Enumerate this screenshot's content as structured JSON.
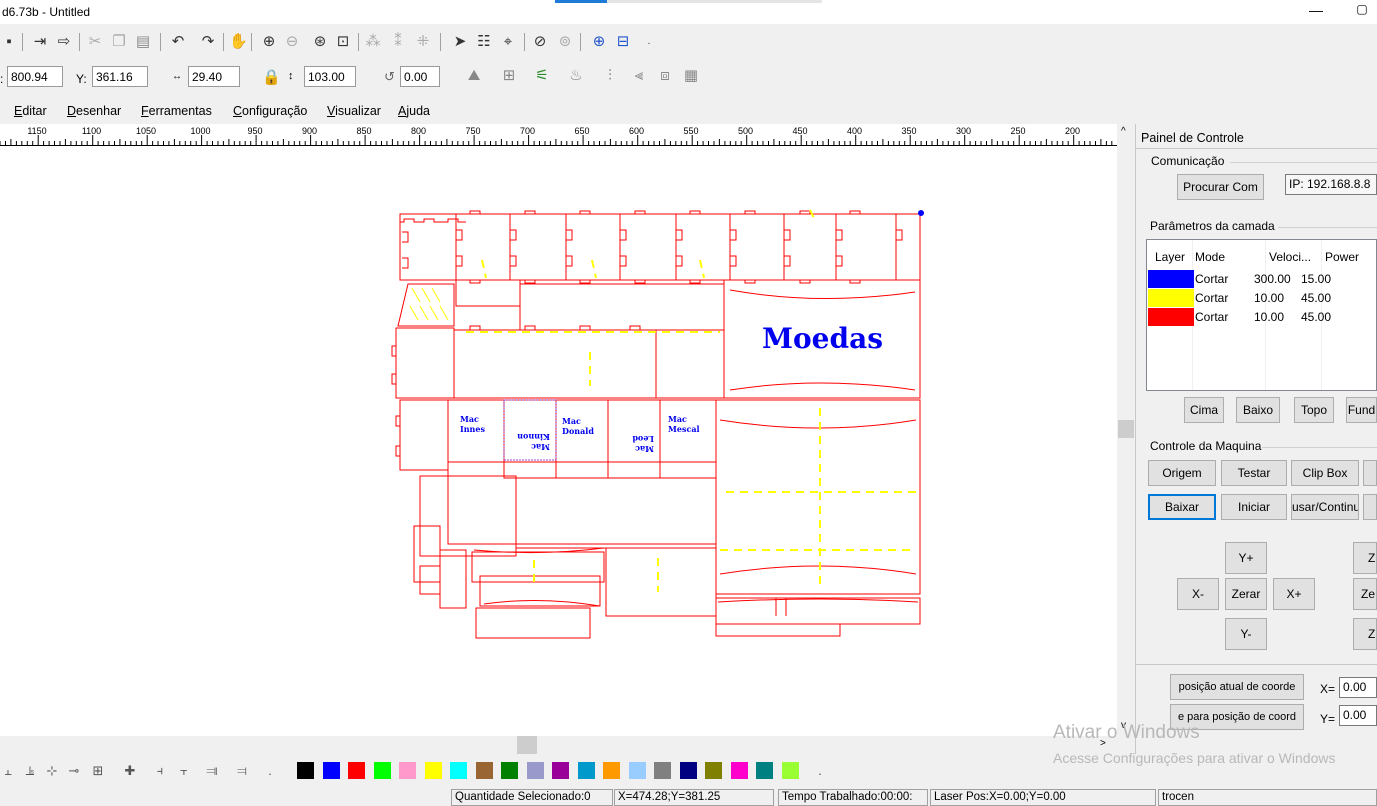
{
  "window": {
    "title": "d6.73b - Untitled",
    "min_glyph": "—",
    "max_glyph": "▢"
  },
  "toolbar_icons": [
    "save-icon",
    "import-icon",
    "export-icon",
    "cut-icon",
    "copy-icon",
    "paste-icon",
    "undo-icon",
    "redo-icon",
    "pan-hand-icon",
    "zoom-in-icon",
    "zoom-out-icon",
    "zoom-fit-icon",
    "zoom-page-icon",
    "group-icon",
    "ungroup-icon",
    "break-icon",
    "select-tool-icon",
    "array-icon",
    "node-edit-icon",
    "offset-icon",
    "weld-icon",
    "focus-icon",
    "preview-icon"
  ],
  "coords": {
    "x_value": "800.94",
    "y_label": "Y:",
    "y_value": "361.16",
    "w_value": "29.40",
    "h_value": "103.00",
    "rot_value": "0.00"
  },
  "menu": [
    {
      "label": "Editar",
      "underline": "E"
    },
    {
      "label": "Desenhar",
      "underline": "D"
    },
    {
      "label": "Ferramentas",
      "underline": "F"
    },
    {
      "label": "Configuração",
      "underline": "C"
    },
    {
      "label": "Visualizar",
      "underline": "V"
    },
    {
      "label": "Ajuda",
      "underline": "A"
    }
  ],
  "ruler": {
    "labels": [
      "1150",
      "1100",
      "1050",
      "1000",
      "950",
      "900",
      "850",
      "800",
      "750",
      "700",
      "650",
      "600",
      "550",
      "500",
      "450",
      "400",
      "350",
      "300",
      "250",
      "200"
    ]
  },
  "canvas": {
    "logo_text": "Moedas",
    "box_labels": [
      "Mac Innes",
      "Mac Kinnon",
      "Mac Donald",
      "Mac Leod",
      "Mac Mescal"
    ]
  },
  "panel": {
    "title": "Painel de Controle",
    "communication": {
      "header": "Comunicação",
      "search_button": "Procurar Com",
      "ip": "IP: 192.168.8.8"
    },
    "layers": {
      "header": "Parâmetros da camada",
      "columns": [
        "Layer",
        "Mode",
        "Veloci...",
        "Power"
      ],
      "rows": [
        {
          "color": "#0000ff",
          "mode": "Cortar",
          "speed": "300.00",
          "power": "15.00"
        },
        {
          "color": "#ffff00",
          "mode": "Cortar",
          "speed": "10.00",
          "power": "45.00"
        },
        {
          "color": "#ff0000",
          "mode": "Cortar",
          "speed": "10.00",
          "power": "45.00"
        }
      ],
      "buttons": [
        "Cima",
        "Baixo",
        "Topo",
        "Fund"
      ]
    },
    "machine": {
      "header": "Controle da Maquina",
      "row1": [
        "Origem",
        "Testar",
        "Clip Box"
      ],
      "row2": [
        "Baixar",
        "Iniciar",
        "usar/Continu"
      ],
      "jog": {
        "y_plus": "Y+",
        "x_minus": "X-",
        "zero": "Zerar",
        "x_plus": "X+",
        "y_minus": "Y-"
      },
      "z_buttons": [
        "Z",
        "Ze",
        "Z"
      ]
    },
    "position": {
      "btn1": "posição atual de coorde",
      "btn2": "e para posição de coord",
      "x_label": "X=",
      "x_value": "0.00",
      "y_label": "Y=",
      "y_value": "0.00"
    }
  },
  "palette": [
    "#000000",
    "#0000ff",
    "#ff0000",
    "#00ff00",
    "#ff99cc",
    "#ffff00",
    "#00ffff",
    "#996633",
    "#008000",
    "#9999cc",
    "#990099",
    "#0099cc",
    "#ff9900",
    "#99ccff",
    "#808080",
    "#000080",
    "#808000",
    "#ff00cc",
    "#008080",
    "#99ff33"
  ],
  "status": {
    "selected": "Quantidade Selecionado:0",
    "mouse": "X=474.28;Y=381.25",
    "time": "Tempo Trabalhado:00:00:",
    "laser": "Laser Pos:X=0.00;Y=0.00",
    "user": "trocen"
  },
  "watermark": {
    "line1": "Ativar o Windows",
    "line2": "Acesse Configurações para ativar o Windows"
  }
}
